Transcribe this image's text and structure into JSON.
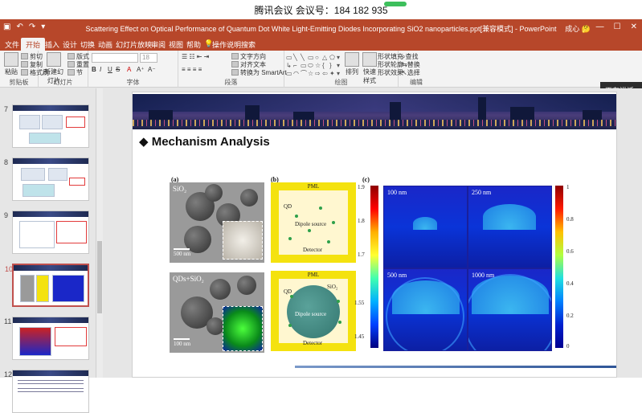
{
  "meeting": {
    "title": "腾讯会议 会议号：184 182 935"
  },
  "window": {
    "title": "Scattering Effect on Optical Performance of Quantum Dot White Light-Emitting Diodes Incorporating SiO2 nanoparticles.ppt[兼容模式] - PowerPoint",
    "user": "成心 🤔",
    "speaking": "正在讲话: 颜"
  },
  "ribbon": {
    "tabs": [
      "文件",
      "开始",
      "插入",
      "设计",
      "切换",
      "动画",
      "幻灯片放映",
      "审阅",
      "视图",
      "帮助",
      "操作说明搜索"
    ],
    "groups": [
      "剪贴板",
      "幻灯片",
      "字体",
      "段落",
      "绘图",
      "编辑"
    ],
    "clipboard": {
      "paste": "粘贴",
      "cut": "剪切",
      "copy": "复制",
      "format": "格式刷"
    },
    "slides": {
      "new": "新建幻灯片",
      "layout": "版式",
      "reset": "重置",
      "section": "节"
    },
    "font": {
      "size": "18",
      "bold": "B",
      "italic": "I",
      "underline": "U",
      "strike": "S"
    },
    "paragraph": {
      "dir": "文字方向",
      "align": "对齐文本",
      "smartart": "转换为 SmartArt"
    },
    "drawing": {
      "arrange": "排列",
      "styles": "快速样式",
      "fill": "形状填充",
      "outline": "形状轮廓",
      "effect": "形状效果"
    },
    "editing": {
      "find": "查找",
      "replace": "替换",
      "select": "选择"
    }
  },
  "thumbnails": [
    {
      "num": "7"
    },
    {
      "num": "8"
    },
    {
      "num": "9"
    },
    {
      "num": "10"
    },
    {
      "num": "11"
    },
    {
      "num": "12"
    }
  ],
  "slide": {
    "heading": "◆ Mechanism Analysis",
    "panel_a": {
      "label": "(a)",
      "top_caption": "SiO₂",
      "bottom_caption": "QDs+SiO₂",
      "scale_top": "500 nm",
      "scale_bottom": "100 nm"
    },
    "panel_b": {
      "label": "(b)",
      "pml": "PML",
      "qd": "QD",
      "dipole": "Dipole source",
      "detector": "Detector",
      "sio2": "SiO₂"
    },
    "panel_c": {
      "label": "(c)",
      "cells": [
        "100 nm",
        "250 nm",
        "500 nm",
        "1000 nm"
      ],
      "left_ticks": [
        "1.9",
        "1.8",
        "1.7",
        "1.55",
        "1.45"
      ],
      "right_ticks": [
        "1",
        "0.8",
        "0.6",
        "0.4",
        "0.2",
        "0"
      ]
    }
  }
}
